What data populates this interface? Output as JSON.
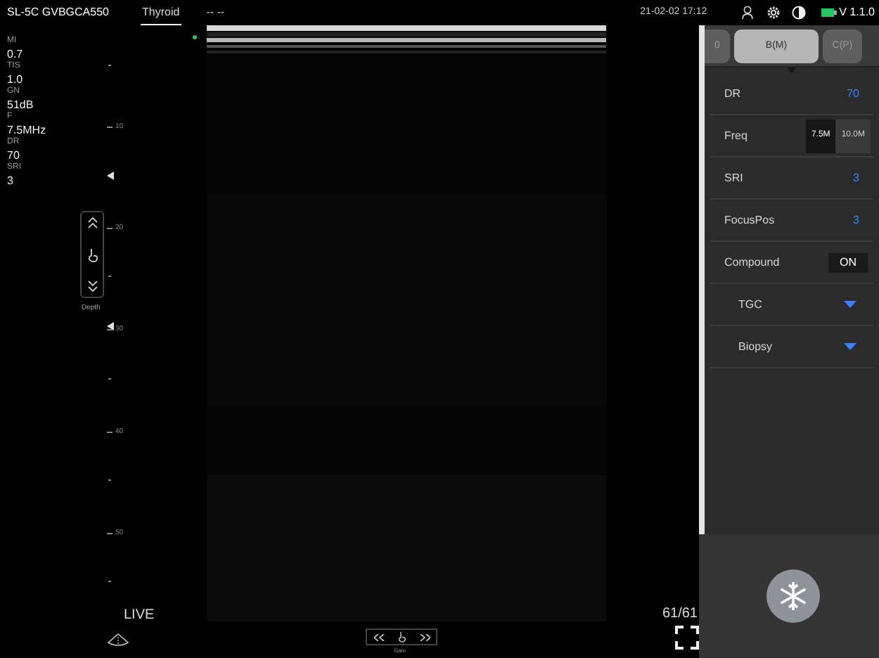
{
  "header": {
    "probe": "SL-5C GVBGCA550",
    "preset": {
      "label": "Thyroid",
      "selected": true
    },
    "mode_text": "-- --",
    "datetime": "21-02-02 17:12",
    "version": "V 1.1.0"
  },
  "params": [
    {
      "label": "MI",
      "value": "0.7"
    },
    {
      "label": "TIS",
      "value": "1.0"
    },
    {
      "label": "GN",
      "value": "51dB"
    },
    {
      "label": "F",
      "value": "7.5MHz"
    },
    {
      "label": "DR",
      "value": "70"
    },
    {
      "label": "SRI",
      "value": "3"
    }
  ],
  "depth": {
    "label": "Depth"
  },
  "ruler": {
    "labels": [
      "10",
      "20",
      "30",
      "40",
      "50"
    ]
  },
  "status": {
    "mode": "LIVE",
    "frame": "61/61"
  },
  "gain": {
    "label": "Gain"
  },
  "panel": {
    "tabs": [
      {
        "label": "0",
        "selected": false
      },
      {
        "label": "B(M)",
        "selected": true
      },
      {
        "label": "C(P)",
        "selected": false
      }
    ],
    "rows": [
      {
        "kind": "value",
        "label": "DR",
        "value": "70"
      },
      {
        "kind": "segmented",
        "label": "Freq",
        "options": [
          {
            "label": "7.5M",
            "selected": true
          },
          {
            "label": "10.0M",
            "selected": false
          }
        ]
      },
      {
        "kind": "value",
        "label": "SRI",
        "value": "3"
      },
      {
        "kind": "value",
        "label": "FocusPos",
        "value": "3"
      },
      {
        "kind": "toggle",
        "label": "Compound",
        "value": "ON"
      },
      {
        "kind": "expander",
        "label": "TGC",
        "expanded": false
      },
      {
        "kind": "expander",
        "label": "Biopsy",
        "expanded": false
      }
    ]
  }
}
